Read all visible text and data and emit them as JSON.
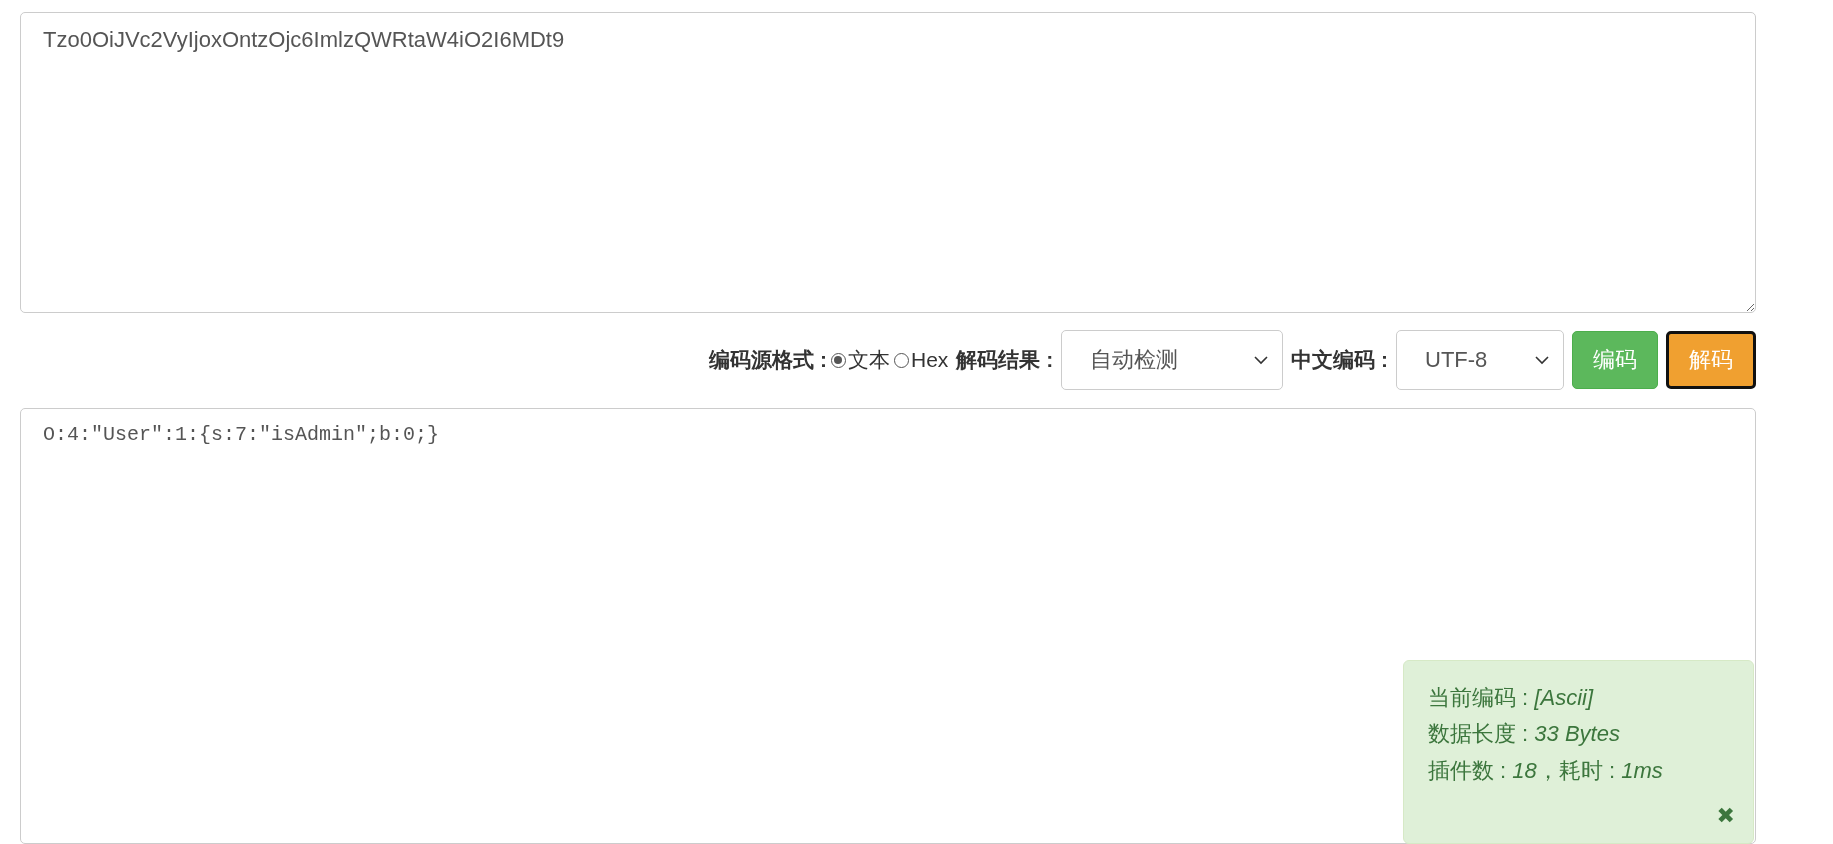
{
  "input": {
    "value": "Tzo0OiJVc2VyIjoxOntzOjc6ImlzQWRtaW4iO2I6MDt9"
  },
  "toolbar": {
    "source_format_label": "编码源格式 :",
    "source_formats": [
      {
        "label": "文本",
        "selected": true
      },
      {
        "label": "Hex",
        "selected": false
      }
    ],
    "result_label": "解码结果 :",
    "result_select": "自动检测",
    "charset_label": "中文编码 :",
    "charset_select": "UTF-8",
    "buttons": [
      {
        "label": "编码",
        "kind": "encode"
      },
      {
        "label": "解码",
        "kind": "decode"
      }
    ]
  },
  "output": {
    "value": "O:4:\"User\":1:{s:7:\"isAdmin\";b:0;}"
  },
  "info_panel": {
    "lines": [
      "当前编码 : *[Ascii]*",
      "数据长度 : *33 Bytes*",
      "插件数 : *18*，耗时 : *1ms*"
    ],
    "close": "✖"
  }
}
